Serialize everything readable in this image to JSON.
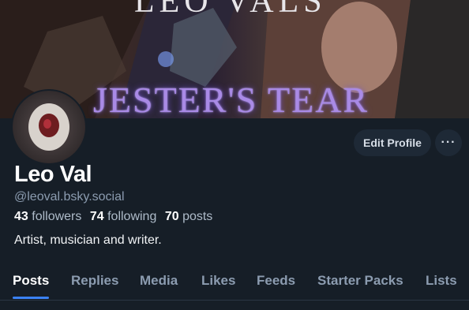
{
  "banner": {
    "top_text": "LEO VALS",
    "title": "JESTER'S TEAR"
  },
  "profile": {
    "display_name": "Leo Val",
    "handle": "@leoval.bsky.social",
    "followers_count": "43",
    "followers_label": "followers",
    "following_count": "74",
    "following_label": "following",
    "posts_count": "70",
    "posts_label": "posts",
    "bio": "Artist, musician and writer."
  },
  "actions": {
    "edit_label": "Edit Profile",
    "more_label": "···"
  },
  "tabs": [
    {
      "label": "Posts",
      "active": true
    },
    {
      "label": "Replies",
      "active": false
    },
    {
      "label": "Media",
      "active": false
    },
    {
      "label": "Likes",
      "active": false
    },
    {
      "label": "Feeds",
      "active": false
    },
    {
      "label": "Starter Packs",
      "active": false
    },
    {
      "label": "Lists",
      "active": false
    }
  ],
  "colors": {
    "background": "#161e27",
    "accent": "#3b82f6",
    "muted_text": "#8c9cb0"
  }
}
